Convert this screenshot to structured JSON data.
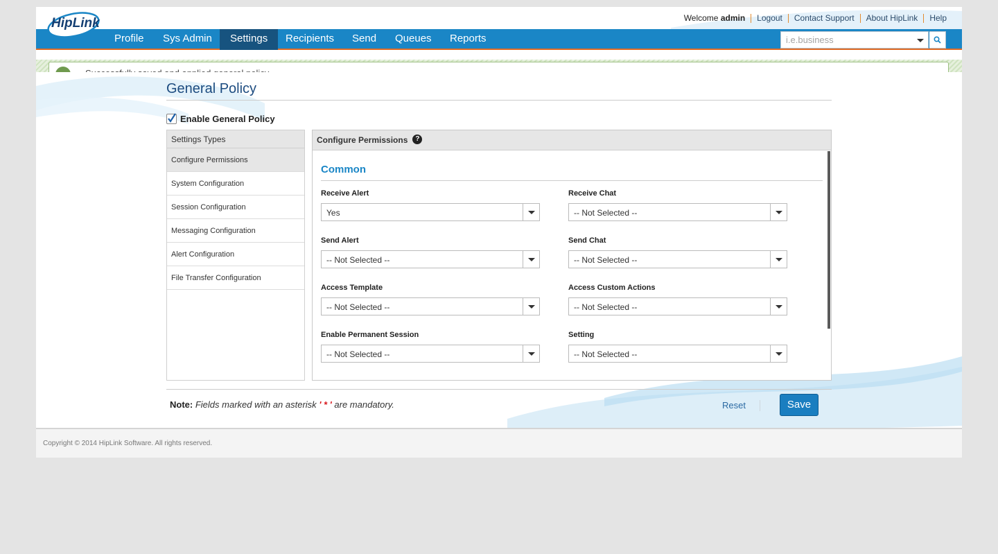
{
  "app": {
    "logo_text": "HipLink"
  },
  "toplinks": {
    "welcome_prefix": "Welcome",
    "username": "admin",
    "logout": "Logout",
    "contact_support": "Contact Support",
    "about": "About HipLink",
    "help": "Help"
  },
  "nav": {
    "items": [
      {
        "label": "Profile"
      },
      {
        "label": "Sys Admin"
      },
      {
        "label": "Settings"
      },
      {
        "label": "Recipients"
      },
      {
        "label": "Send"
      },
      {
        "label": "Queues"
      },
      {
        "label": "Reports"
      }
    ],
    "active": "Settings",
    "search_placeholder": "i.e.business"
  },
  "notice": {
    "text": "Successfully saved and applied general policy"
  },
  "page": {
    "title": "General Policy",
    "enable_label": "Enable General Policy",
    "enable_checked": true
  },
  "settings_types": {
    "header": "Settings Types",
    "items": [
      {
        "label": "Configure Permissions"
      },
      {
        "label": "System Configuration"
      },
      {
        "label": "Session Configuration"
      },
      {
        "label": "Messaging Configuration"
      },
      {
        "label": "Alert Configuration"
      },
      {
        "label": "File Transfer Configuration"
      }
    ],
    "active": "Configure Permissions"
  },
  "permissions": {
    "header": "Configure Permissions",
    "section_title": "Common",
    "fields": [
      {
        "label": "Receive Alert",
        "value": "Yes"
      },
      {
        "label": "Receive Chat",
        "value": "-- Not Selected --"
      },
      {
        "label": "Send Alert",
        "value": "-- Not Selected --"
      },
      {
        "label": "Send Chat",
        "value": "-- Not Selected --"
      },
      {
        "label": "Access Template",
        "value": "-- Not Selected --"
      },
      {
        "label": "Access Custom Actions",
        "value": "-- Not Selected --"
      },
      {
        "label": "Enable Permanent Session",
        "value": "-- Not Selected --"
      },
      {
        "label": "Setting",
        "value": "-- Not Selected --"
      }
    ]
  },
  "actions": {
    "note_label": "Note:",
    "note_text_before": "Fields marked with an asterisk",
    "note_asterisk": "' * '",
    "note_text_after": "are mandatory.",
    "reset": "Reset",
    "save": "Save"
  },
  "footer": {
    "copyright": "Copyright © 2014 HipLink Software. All rights reserved."
  },
  "colors": {
    "nav_bg": "#1a86c6",
    "nav_active": "#17537f",
    "accent_orange": "#e06a24",
    "title_blue": "#1d4c80",
    "save_button": "#1a7ec0"
  }
}
